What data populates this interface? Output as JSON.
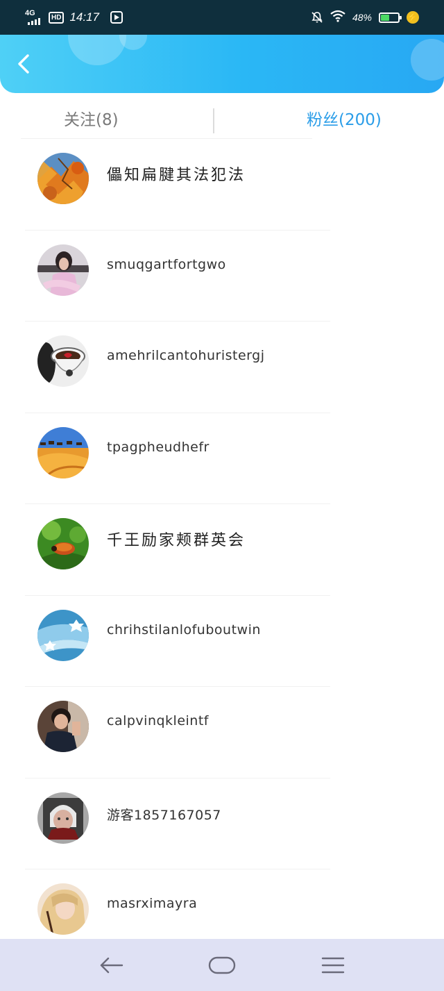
{
  "status_bar": {
    "network": "4G",
    "hd_badge": "HD",
    "time": "14:17",
    "battery_percent": "48%",
    "battery_level": 0.48,
    "charging_symbol": "⚡"
  },
  "header": {
    "back_icon": "chevron-left-icon"
  },
  "tabs": {
    "following_label": "关注(8)",
    "fans_label": "粉丝(200)",
    "active": "fans",
    "active_color": "#2a9de8",
    "inactive_color": "#7a7a7a"
  },
  "fans": [
    {
      "name": "儡知扁腱其法犯法",
      "avatar": "autumn-leaves"
    },
    {
      "name": "smuqgartfortgwo",
      "avatar": "woman-photo"
    },
    {
      "name": "amehrilcantohuristergj",
      "avatar": "coffee-cup"
    },
    {
      "name": "tpagpheudhefr",
      "avatar": "desert-camels"
    },
    {
      "name": "千王励家颊群英会",
      "avatar": "ladybug-grass"
    },
    {
      "name": "chrihstilanlofuboutwin",
      "avatar": "blue-flowers"
    },
    {
      "name": "calpvinqkleintf",
      "avatar": "man-photo"
    },
    {
      "name": "游客1857167057",
      "avatar": "anime-elder"
    },
    {
      "name": "masrximayra",
      "avatar": "blonde-girl"
    }
  ],
  "nav_bar": {
    "back_icon": "nav-back-icon",
    "home_icon": "nav-home-icon",
    "menu_icon": "nav-menu-icon"
  },
  "colors": {
    "header_start": "#4fd0f6",
    "header_end": "#28a8f3",
    "status_bar_bg": "#0f2f3d",
    "nav_bar_bg": "#dfe1f4"
  }
}
